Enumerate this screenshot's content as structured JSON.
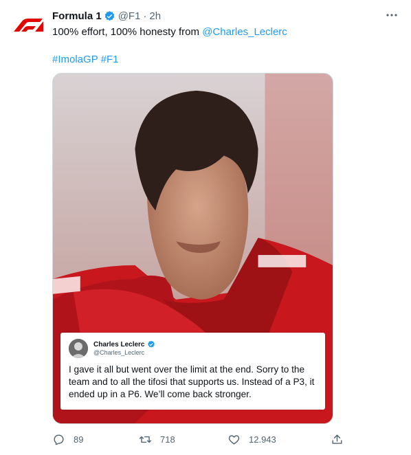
{
  "tweet": {
    "author_name": "Formula 1",
    "author_handle": "@F1",
    "separator": "·",
    "time": "2h",
    "text_prefix": "100% effort, 100% honesty from ",
    "mention": "@Charles_Leclerc",
    "hashtags": [
      "#ImolaGP",
      "#F1"
    ],
    "brand_color": "#e10600",
    "link_color": "#1d9bf0"
  },
  "quote_card": {
    "name": "Charles Leclerc",
    "handle": "@Charles_Leclerc",
    "text": "I gave it all but went over the limit at the end. Sorry to the team and to all the tifosi that supports us. Instead of a P3, it ended up in a P6. We’ll come back stronger."
  },
  "actions": {
    "replies": "89",
    "retweets": "718",
    "likes": "12.943",
    "icons": [
      "reply-icon",
      "retweet-icon",
      "like-icon",
      "share-icon"
    ]
  }
}
